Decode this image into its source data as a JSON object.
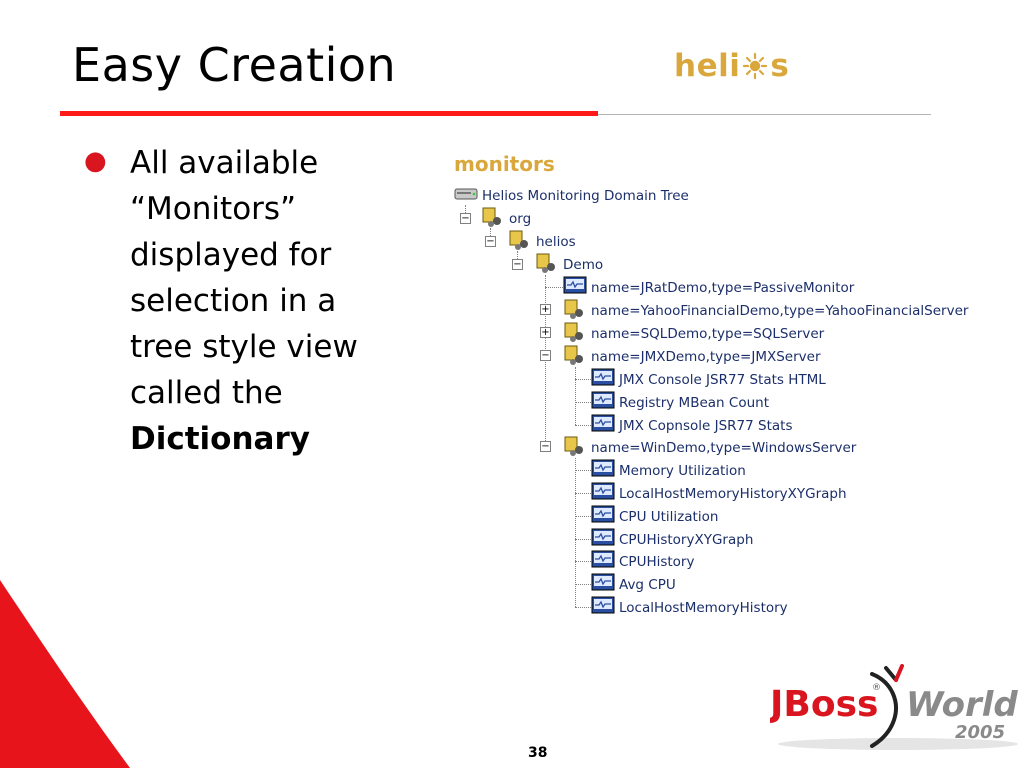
{
  "slide": {
    "title": "Easy Creation",
    "number": "38"
  },
  "logo_helios": {
    "text_left": "heli",
    "text_right": "s",
    "color": "#d9a73c"
  },
  "bullet": {
    "lines": [
      "All available",
      "“Monitors”",
      "displayed for",
      "selection in a",
      "tree style view",
      "called the"
    ],
    "bold_word": "Dictionary",
    "dot_color": "#d9161f"
  },
  "monitors_heading": "monitors",
  "tree": {
    "root": "Helios Monitoring Domain Tree",
    "org": "org",
    "helios": "helios",
    "demo": "Demo",
    "jrat": "name=JRatDemo,type=PassiveMonitor",
    "yahoo": "name=YahooFinancialDemo,type=YahooFinancialServer",
    "sql": "name=SQLDemo,type=SQLServer",
    "jmx": "name=JMXDemo,type=JMXServer",
    "jmx_children": [
      "JMX Console JSR77 Stats HTML",
      "Registry MBean Count",
      "JMX Copnsole JSR77 Stats"
    ],
    "win": "name=WinDemo,type=WindowsServer",
    "win_children": [
      "Memory Utilization",
      "LocalHostMemoryHistoryXYGraph",
      "CPU Utilization",
      "CPUHistoryXYGraph",
      "CPUHistory",
      "Avg CPU",
      "LocalHostMemoryHistory"
    ],
    "text_color": "#1c2f6a"
  },
  "logo_jboss": {
    "brand": "JBoss",
    "registered": "®",
    "world": "World",
    "year": "2005",
    "brand_color": "#d9161f",
    "world_color": "#8a8a8a"
  },
  "colors": {
    "accent_red": "#ff1a1a",
    "rule_grey": "#b5b5b5"
  }
}
